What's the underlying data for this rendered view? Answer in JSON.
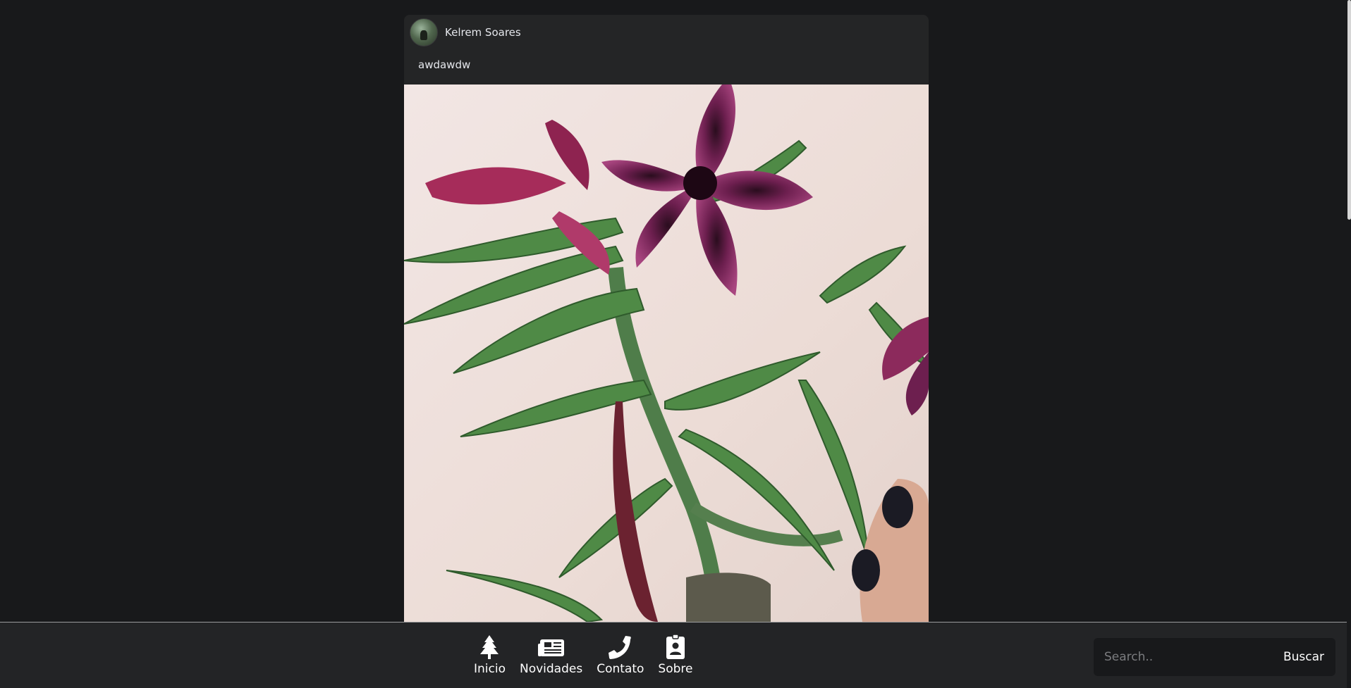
{
  "post": {
    "author": "Kelrem Soares",
    "caption": "awdawdw"
  },
  "nav": {
    "items": [
      {
        "label": "Inicio",
        "icon": "tree-icon"
      },
      {
        "label": "Novidades",
        "icon": "newspaper-icon"
      },
      {
        "label": "Contato",
        "icon": "phone-icon"
      },
      {
        "label": "Sobre",
        "icon": "id-badge-icon"
      }
    ]
  },
  "search": {
    "placeholder": "Search..",
    "button_label": "Buscar"
  },
  "colors": {
    "background": "#18191b",
    "card": "#242526",
    "bar": "#232426"
  }
}
